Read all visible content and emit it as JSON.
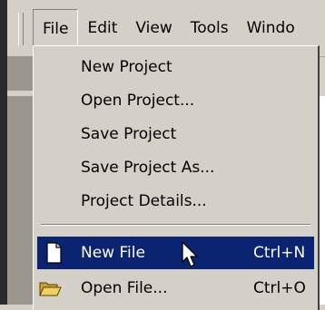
{
  "menubar": {
    "items": [
      {
        "label": "File",
        "open": true
      },
      {
        "label": "Edit"
      },
      {
        "label": "View"
      },
      {
        "label": "Tools"
      },
      {
        "label": "Windo"
      }
    ]
  },
  "file_menu": {
    "items": [
      {
        "label": "New Project",
        "shortcut": ""
      },
      {
        "label": "Open Project...",
        "shortcut": ""
      },
      {
        "label": "Save Project",
        "shortcut": ""
      },
      {
        "label": "Save Project As...",
        "shortcut": ""
      },
      {
        "label": "Project Details...",
        "shortcut": ""
      },
      {
        "label": "New File",
        "shortcut": "Ctrl+N",
        "icon": "new-file-icon",
        "highlighted": true
      },
      {
        "label": "Open File...",
        "shortcut": "Ctrl+O",
        "icon": "open-folder-icon"
      }
    ]
  },
  "colors": {
    "highlight": "#0a2471",
    "menu_bg": "#d4d0c8"
  }
}
